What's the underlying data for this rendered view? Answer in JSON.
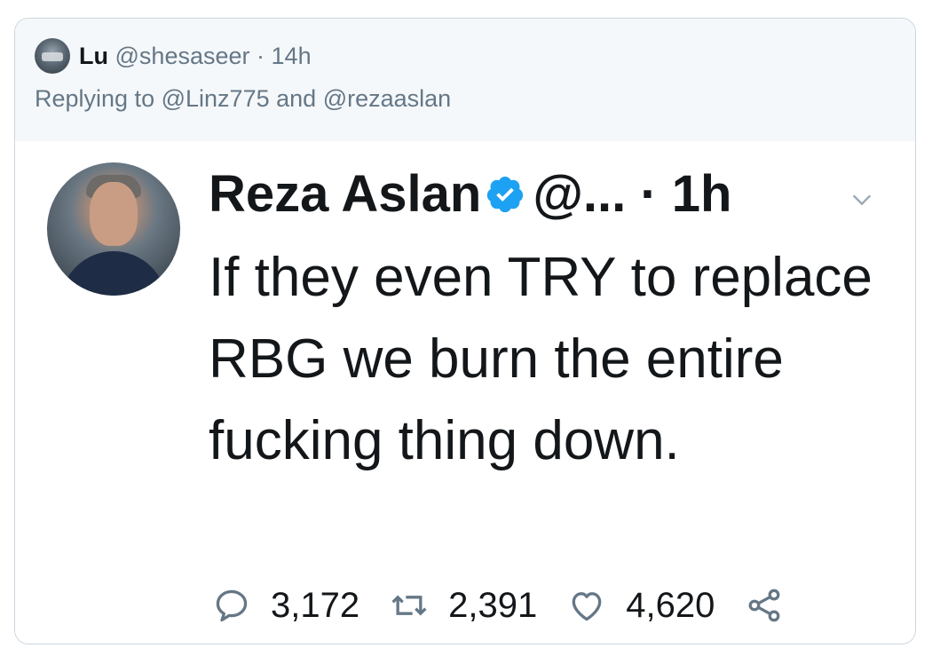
{
  "outer_tweet": {
    "name": "Lu",
    "handle": "@shesaseer",
    "separator": "·",
    "time": "14h",
    "replying_prefix": "Replying to",
    "mention_1": "@Linz775",
    "conjunction": "and",
    "mention_2": "@rezaaslan"
  },
  "quoted_tweet": {
    "name": "Reza Aslan",
    "handle": "@...",
    "separator": "·",
    "time": "1h",
    "text": "If they even TRY to replace RBG we burn the entire fucking thing down.",
    "replies": "3,172",
    "retweets": "2,391",
    "likes": "4,620"
  },
  "colors": {
    "verified": "#1da1f2",
    "secondary_text": "#657786",
    "border": "#ccd6dd",
    "icon_gray": "#657786"
  },
  "icons": [
    "avatar",
    "verified-badge-icon",
    "chevron-down-icon",
    "reply-icon",
    "retweet-icon",
    "like-icon",
    "share-icon"
  ]
}
